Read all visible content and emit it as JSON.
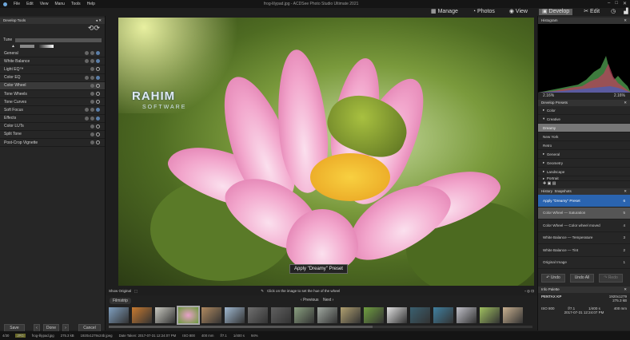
{
  "menu": [
    "File",
    "Edit",
    "View",
    "Manu",
    "Tools",
    "Help"
  ],
  "window_title": "frog-lilypad.jpg - ACDSee Photo Studio Ultimate 2021",
  "modes": [
    "Manage",
    "Photos",
    "View",
    "Develop",
    "Edit"
  ],
  "left": {
    "title": "Develop Tools",
    "tab": "Tune",
    "tools": [
      "General",
      "White Balance",
      "Light EQ™",
      "Color EQ",
      "Color Wheel",
      "Tone Wheels",
      "Tone Curves",
      "Soft Focus",
      "Effects",
      "Color LUTs",
      "Split Tone",
      "Post-Crop Vignette"
    ],
    "save": "Save",
    "done": "Done",
    "cancel": "Cancel"
  },
  "watermark": {
    "line1": "RAHIM",
    "line2": "SOFTWARE"
  },
  "tooltip": "Apply \"Dreamy\" Preset",
  "showbar": {
    "show_original": "Show Original",
    "hint": "Click on the image to set the hue of the wheel"
  },
  "filmstrip": {
    "title": "Filmstrip",
    "previous": "Previous",
    "next": "Next",
    "thumb_colors": [
      "#7f9fbf",
      "#c87a30",
      "#c8c8c0",
      "#8fb07a",
      "#b08a60",
      "#a0b8d0",
      "#707070",
      "#606060",
      "#8aa080",
      "#a0a8a0",
      "#b0a070",
      "#70a040",
      "#e0e0e0",
      "#3a6070",
      "#4080a0",
      "#c0c0c8",
      "#a0c060",
      "#c8b090"
    ]
  },
  "status": [
    "4/30",
    "JPG",
    "frog-lilypad.jpg",
    "275.3 kB",
    "1920x1279x24b jpeg",
    "Date Taken: 2017-07-31 12:24:07 PM",
    "ISO 800",
    "400 mm",
    "f/7.1",
    "1/400 s",
    "94%"
  ],
  "right": {
    "histogram_title": "Histogram",
    "hist_left": "2.16%",
    "hist_right": "2.16%",
    "presets_title": "Develop Presets",
    "presets": [
      "Color",
      "Creative",
      "Dreamy",
      "New York",
      "Retro",
      "General",
      "Geometry",
      "Landscape",
      "Portrait"
    ],
    "history_tabs": [
      "History",
      "Snapshots"
    ],
    "history": [
      {
        "label": "Apply \"Dreamy\" Preset",
        "n": "6"
      },
      {
        "label": "Color Wheel — Saturation",
        "n": "5"
      },
      {
        "label": "Color Wheel — Color wheel moved",
        "n": "4"
      },
      {
        "label": "White Balance — Temperature",
        "n": "3"
      },
      {
        "label": "White Balance — Tint",
        "n": "2"
      },
      {
        "label": "Original Image",
        "n": "1"
      }
    ],
    "undo": "Undo",
    "undo_all": "Undo All",
    "redo": "Redo",
    "info_title": "Info Palette",
    "camera": "PENTAX KP",
    "dims": "1920x1279",
    "size": "275.3 kB",
    "iso": "ISO 800",
    "fstop": "f/7.1",
    "shutter": "1/400 s",
    "focal": "400 mm",
    "date": "2017-07-31 12:24:07 PM"
  }
}
